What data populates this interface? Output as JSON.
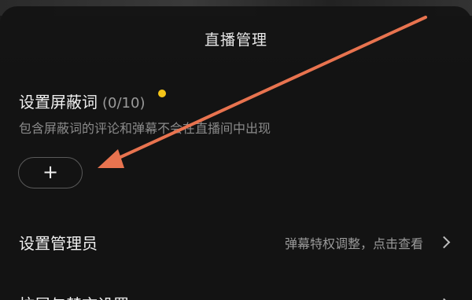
{
  "header": {
    "title": "直播管理"
  },
  "block_words": {
    "title": "设置屏蔽词",
    "count": "(0/10)",
    "description": "包含屏蔽词的评论和弹幕不会在直播间中出现",
    "add_label": "+"
  },
  "admins_row": {
    "label": "设置管理员",
    "hint": "弹幕特权调整，点击查看"
  },
  "next_row": {
    "label": "抗屏与禁言设置"
  },
  "colors": {
    "accent_dot": "#f5c518",
    "annotation_arrow": "#e8734f"
  }
}
